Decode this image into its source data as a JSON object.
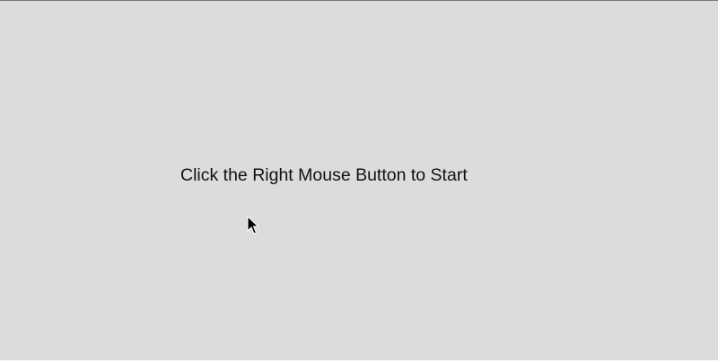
{
  "canvas": {
    "background_color": "#dcdcdc",
    "instruction_text": "Click the Right Mouse Button to Start"
  },
  "cursor": {
    "icon": "arrow-pointer-icon"
  }
}
